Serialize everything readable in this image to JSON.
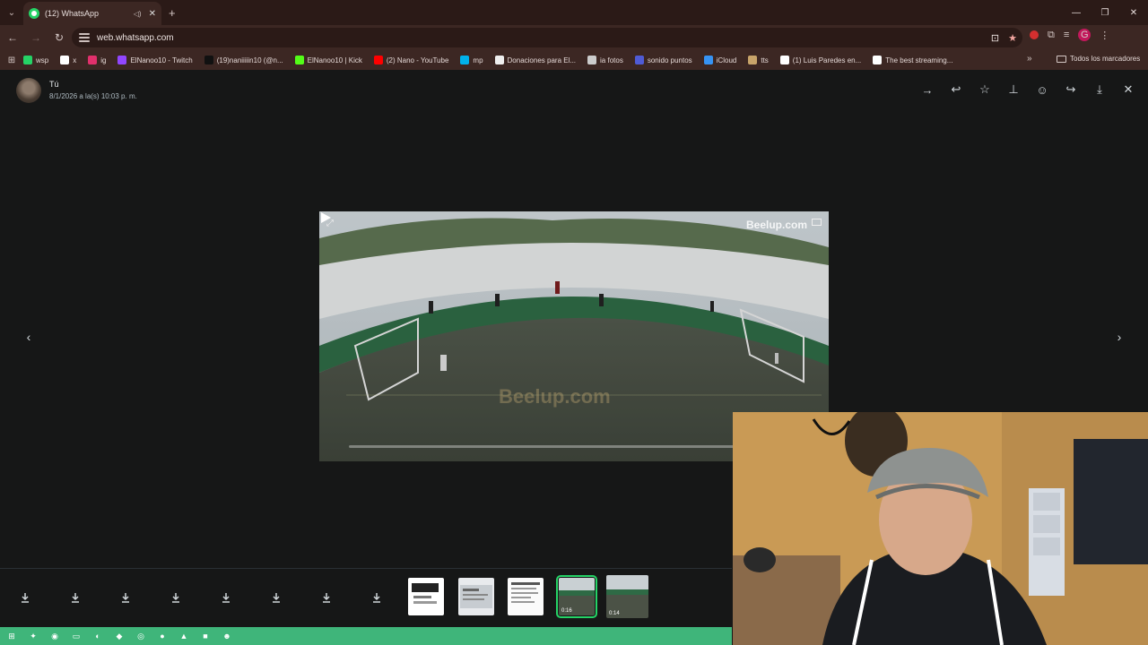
{
  "browser": {
    "tab_title": "(12) WhatsApp",
    "url": "web.whatsapp.com",
    "bookmarks": [
      {
        "label": "wsp",
        "icon": "whatsapp-icon",
        "color": "#25d366"
      },
      {
        "label": "x",
        "icon": "x-icon",
        "color": "#ffffff"
      },
      {
        "label": "ig",
        "icon": "instagram-icon",
        "color": "#e1306c"
      },
      {
        "label": "ElNanoo10 - Twitch",
        "icon": "twitch-icon",
        "color": "#9146ff"
      },
      {
        "label": "(19)naniiiiin10 (@n...",
        "icon": "tiktok-icon",
        "color": "#111111"
      },
      {
        "label": "ElNanoo10 | Kick",
        "icon": "kick-icon",
        "color": "#53fc18"
      },
      {
        "label": "(2) Nano - YouTube",
        "icon": "youtube-icon",
        "color": "#ff0000"
      },
      {
        "label": "mp",
        "icon": "mercadopago-icon",
        "color": "#00b1ea"
      },
      {
        "label": "Donaciones para El...",
        "icon": "donation-icon",
        "color": "#eeeeee"
      },
      {
        "label": "ia fotos",
        "icon": "doc-icon",
        "color": "#cccccc"
      },
      {
        "label": "sonido puntos",
        "icon": "sound-icon",
        "color": "#4f5bd5"
      },
      {
        "label": "iCloud",
        "icon": "icloud-icon",
        "color": "#3693f3"
      },
      {
        "label": "tts",
        "icon": "folder-icon",
        "color": "#c8a46a"
      },
      {
        "label": "(1) Luis Paredes en...",
        "icon": "x-icon",
        "color": "#ffffff"
      },
      {
        "label": "The best streaming...",
        "icon": "diamond-icon",
        "color": "#ffffff"
      }
    ],
    "all_bookmarks_label": "Todos los marcadores",
    "profile_initial": "G"
  },
  "viewer": {
    "sender": "Tú",
    "sent_at": "8/1/2026 a la(s) 10:03 p. m.",
    "video": {
      "watermark_top": "Beelup.com",
      "watermark_center": "Beelup.com",
      "progress": 0.0
    },
    "thumbnails": [
      {
        "kind": "document"
      },
      {
        "kind": "screenshot"
      },
      {
        "kind": "document"
      },
      {
        "kind": "video",
        "duration": "0:16",
        "active": true
      },
      {
        "kind": "video",
        "duration": "0:14",
        "active": false
      }
    ]
  },
  "colors": {
    "accent": "#25d366",
    "taskbar": "#3fb57a"
  }
}
